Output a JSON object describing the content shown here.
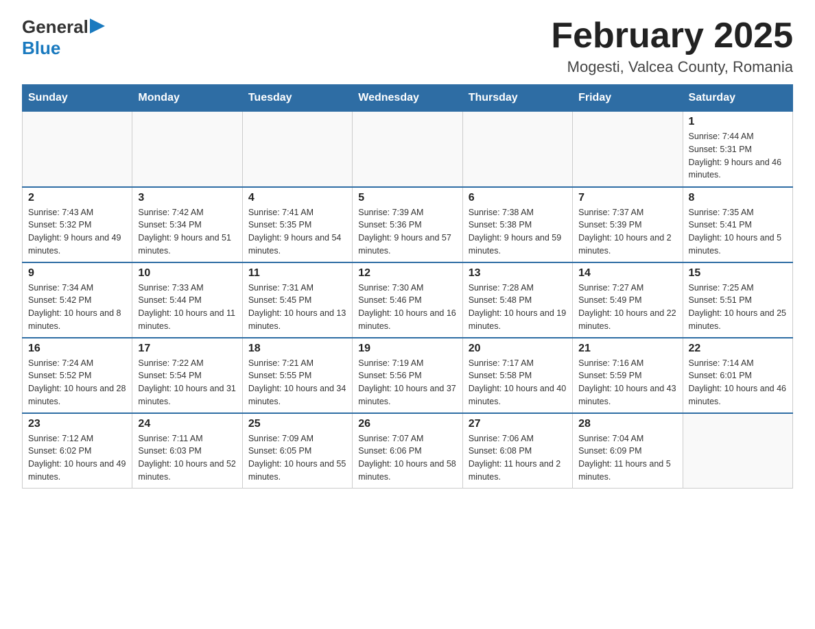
{
  "header": {
    "logo": {
      "text_general": "General",
      "text_blue": "Blue",
      "arrow_unicode": "▶"
    },
    "title": "February 2025",
    "location": "Mogesti, Valcea County, Romania"
  },
  "calendar": {
    "days_of_week": [
      "Sunday",
      "Monday",
      "Tuesday",
      "Wednesday",
      "Thursday",
      "Friday",
      "Saturday"
    ],
    "weeks": [
      [
        {
          "day": "",
          "info": ""
        },
        {
          "day": "",
          "info": ""
        },
        {
          "day": "",
          "info": ""
        },
        {
          "day": "",
          "info": ""
        },
        {
          "day": "",
          "info": ""
        },
        {
          "day": "",
          "info": ""
        },
        {
          "day": "1",
          "info": "Sunrise: 7:44 AM\nSunset: 5:31 PM\nDaylight: 9 hours and 46 minutes."
        }
      ],
      [
        {
          "day": "2",
          "info": "Sunrise: 7:43 AM\nSunset: 5:32 PM\nDaylight: 9 hours and 49 minutes."
        },
        {
          "day": "3",
          "info": "Sunrise: 7:42 AM\nSunset: 5:34 PM\nDaylight: 9 hours and 51 minutes."
        },
        {
          "day": "4",
          "info": "Sunrise: 7:41 AM\nSunset: 5:35 PM\nDaylight: 9 hours and 54 minutes."
        },
        {
          "day": "5",
          "info": "Sunrise: 7:39 AM\nSunset: 5:36 PM\nDaylight: 9 hours and 57 minutes."
        },
        {
          "day": "6",
          "info": "Sunrise: 7:38 AM\nSunset: 5:38 PM\nDaylight: 9 hours and 59 minutes."
        },
        {
          "day": "7",
          "info": "Sunrise: 7:37 AM\nSunset: 5:39 PM\nDaylight: 10 hours and 2 minutes."
        },
        {
          "day": "8",
          "info": "Sunrise: 7:35 AM\nSunset: 5:41 PM\nDaylight: 10 hours and 5 minutes."
        }
      ],
      [
        {
          "day": "9",
          "info": "Sunrise: 7:34 AM\nSunset: 5:42 PM\nDaylight: 10 hours and 8 minutes."
        },
        {
          "day": "10",
          "info": "Sunrise: 7:33 AM\nSunset: 5:44 PM\nDaylight: 10 hours and 11 minutes."
        },
        {
          "day": "11",
          "info": "Sunrise: 7:31 AM\nSunset: 5:45 PM\nDaylight: 10 hours and 13 minutes."
        },
        {
          "day": "12",
          "info": "Sunrise: 7:30 AM\nSunset: 5:46 PM\nDaylight: 10 hours and 16 minutes."
        },
        {
          "day": "13",
          "info": "Sunrise: 7:28 AM\nSunset: 5:48 PM\nDaylight: 10 hours and 19 minutes."
        },
        {
          "day": "14",
          "info": "Sunrise: 7:27 AM\nSunset: 5:49 PM\nDaylight: 10 hours and 22 minutes."
        },
        {
          "day": "15",
          "info": "Sunrise: 7:25 AM\nSunset: 5:51 PM\nDaylight: 10 hours and 25 minutes."
        }
      ],
      [
        {
          "day": "16",
          "info": "Sunrise: 7:24 AM\nSunset: 5:52 PM\nDaylight: 10 hours and 28 minutes."
        },
        {
          "day": "17",
          "info": "Sunrise: 7:22 AM\nSunset: 5:54 PM\nDaylight: 10 hours and 31 minutes."
        },
        {
          "day": "18",
          "info": "Sunrise: 7:21 AM\nSunset: 5:55 PM\nDaylight: 10 hours and 34 minutes."
        },
        {
          "day": "19",
          "info": "Sunrise: 7:19 AM\nSunset: 5:56 PM\nDaylight: 10 hours and 37 minutes."
        },
        {
          "day": "20",
          "info": "Sunrise: 7:17 AM\nSunset: 5:58 PM\nDaylight: 10 hours and 40 minutes."
        },
        {
          "day": "21",
          "info": "Sunrise: 7:16 AM\nSunset: 5:59 PM\nDaylight: 10 hours and 43 minutes."
        },
        {
          "day": "22",
          "info": "Sunrise: 7:14 AM\nSunset: 6:01 PM\nDaylight: 10 hours and 46 minutes."
        }
      ],
      [
        {
          "day": "23",
          "info": "Sunrise: 7:12 AM\nSunset: 6:02 PM\nDaylight: 10 hours and 49 minutes."
        },
        {
          "day": "24",
          "info": "Sunrise: 7:11 AM\nSunset: 6:03 PM\nDaylight: 10 hours and 52 minutes."
        },
        {
          "day": "25",
          "info": "Sunrise: 7:09 AM\nSunset: 6:05 PM\nDaylight: 10 hours and 55 minutes."
        },
        {
          "day": "26",
          "info": "Sunrise: 7:07 AM\nSunset: 6:06 PM\nDaylight: 10 hours and 58 minutes."
        },
        {
          "day": "27",
          "info": "Sunrise: 7:06 AM\nSunset: 6:08 PM\nDaylight: 11 hours and 2 minutes."
        },
        {
          "day": "28",
          "info": "Sunrise: 7:04 AM\nSunset: 6:09 PM\nDaylight: 11 hours and 5 minutes."
        },
        {
          "day": "",
          "info": ""
        }
      ]
    ]
  }
}
